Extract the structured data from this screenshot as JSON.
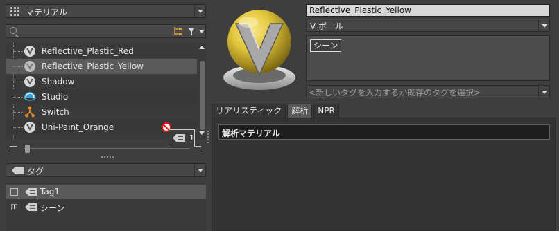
{
  "material_dropdown": {
    "label": "マテリアル"
  },
  "search": {
    "placeholder": ""
  },
  "materials": [
    {
      "name": "Reflective_Plastic_Red",
      "icon": "v-ball-icon",
      "selected": false
    },
    {
      "name": "Reflective_Plastic_Yellow",
      "icon": "v-ball-icon",
      "selected": true
    },
    {
      "name": "Shadow",
      "icon": "v-ball-icon",
      "selected": false
    },
    {
      "name": "Studio",
      "icon": "studio-icon",
      "selected": false
    },
    {
      "name": "Switch",
      "icon": "switch-icon",
      "selected": false
    },
    {
      "name": "Uni-Paint_Orange",
      "icon": "v-ball-icon",
      "selected": false
    }
  ],
  "tag_count": "1",
  "tag_dropdown": {
    "label": "タグ"
  },
  "tag_tree": [
    {
      "name": "Tag1",
      "selected": true
    },
    {
      "name": "シーン",
      "selected": false
    }
  ],
  "material_name": "Reflective_Plastic_Yellow",
  "material_type": "V ボール",
  "tags": [
    "シーン"
  ],
  "tag_input_placeholder": "<新しいタグを入力するか既存のタグを選択>",
  "tabs": [
    {
      "label": "リアリスティック",
      "active": false
    },
    {
      "label": "解析",
      "active": true
    },
    {
      "label": "NPR",
      "active": false
    }
  ],
  "section_title": "解析マテリアル",
  "colors": {
    "accent_yellow": "#e2c63a",
    "selection": "#5a5a5a"
  }
}
